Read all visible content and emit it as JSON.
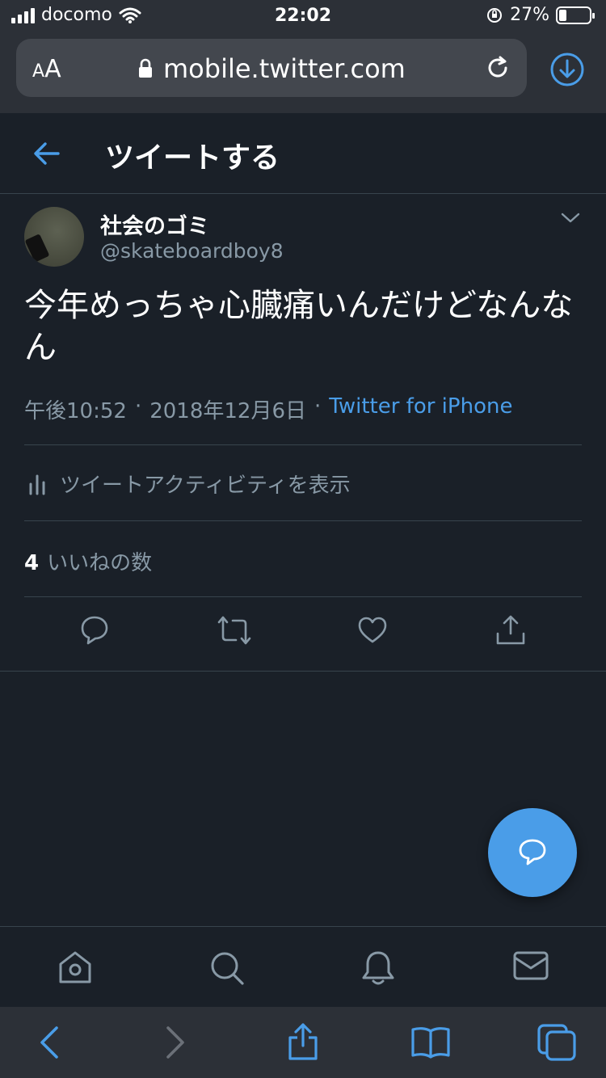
{
  "status_bar": {
    "carrier": "docomo",
    "time": "22:02",
    "battery": "27%",
    "battery_level": 0.27
  },
  "browser": {
    "text_size_button": "AA",
    "url": "mobile.twitter.com"
  },
  "header": {
    "title": "ツイートする"
  },
  "tweet": {
    "author_name": "社会のゴミ",
    "author_handle": "@skateboardboy8",
    "text": "今年めっちゃ心臓痛いんだけどなんなん",
    "time": "午後10:52",
    "date": "2018年12月6日",
    "separator": "·",
    "source": "Twitter for iPhone",
    "activity_label": "ツイートアクティビティを表示",
    "likes_count": "4",
    "likes_label": "いいねの数"
  },
  "icons": {
    "back": "arrow-left-icon",
    "reply": "reply-icon",
    "retweet": "retweet-icon",
    "like": "heart-icon",
    "share": "share-icon",
    "compose": "compose-icon"
  },
  "colors": {
    "background": "#1a2028",
    "accent": "#4a9de8",
    "secondary_text": "#8899a6",
    "divider": "#38444d",
    "browser_chrome": "#2c3037"
  }
}
